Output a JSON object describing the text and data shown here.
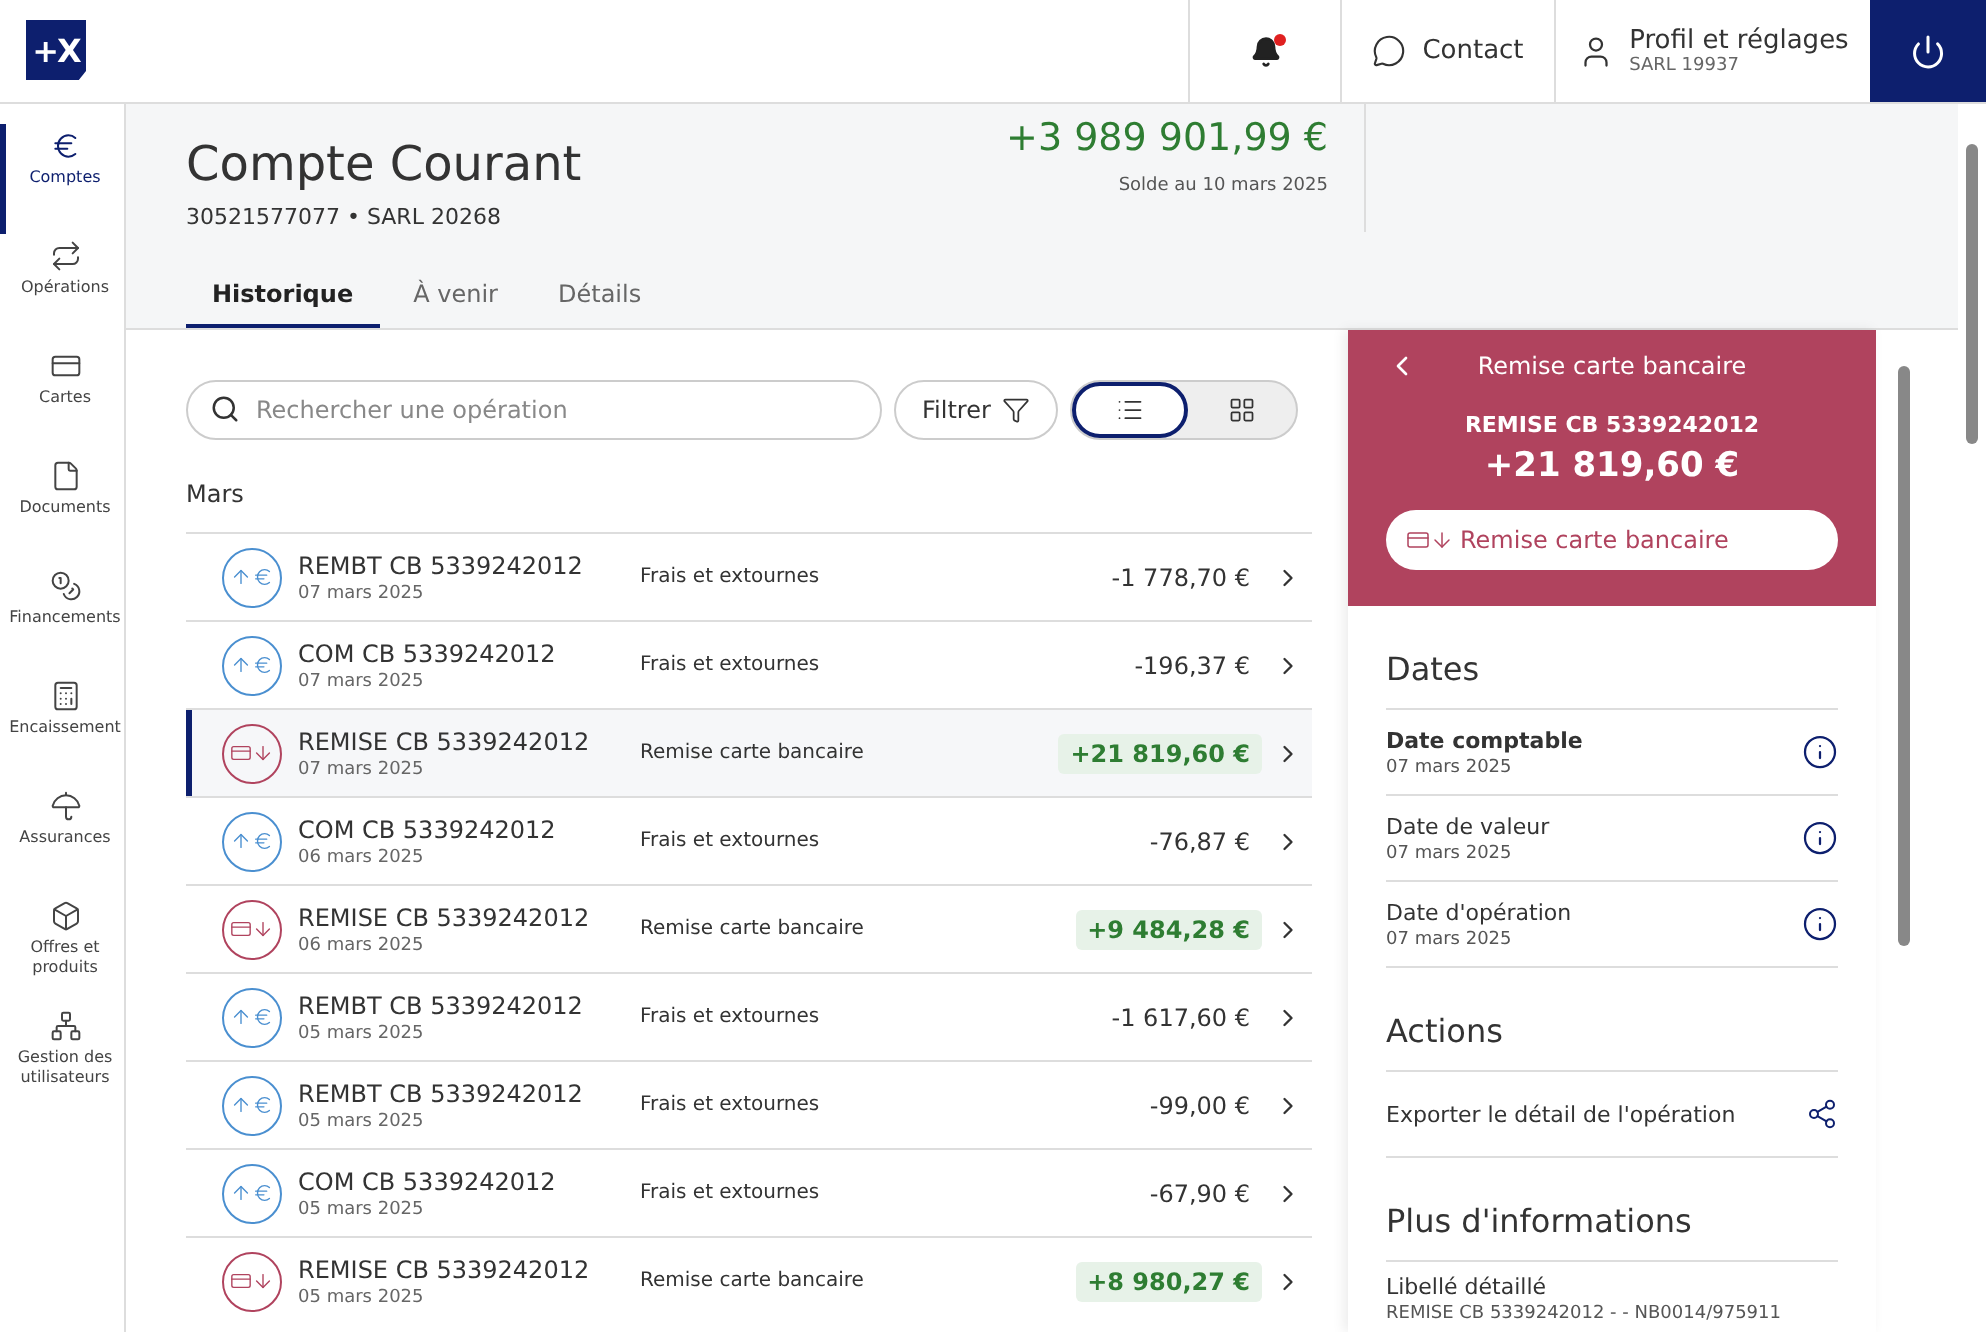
{
  "logo": "+X",
  "topbar": {
    "notification": true,
    "contact": "Contact",
    "profile": {
      "title": "Profil et réglages",
      "subtitle": "SARL 19937"
    }
  },
  "sidebar": [
    {
      "kind": "euro",
      "label": "Comptes",
      "selected": true
    },
    {
      "kind": "transfer",
      "label": "Opérations",
      "selected": false
    },
    {
      "kind": "card",
      "label": "Cartes",
      "selected": false
    },
    {
      "kind": "document",
      "label": "Documents",
      "selected": false
    },
    {
      "kind": "moneybag",
      "label": "Financements",
      "selected": false
    },
    {
      "kind": "calculator",
      "label": "Encaissement",
      "selected": false
    },
    {
      "kind": "umbrella",
      "label": "Assurances",
      "selected": false
    },
    {
      "kind": "box",
      "label": "Offres et produits",
      "selected": false
    },
    {
      "kind": "network",
      "label": "Gestion des utilisateurs",
      "selected": false
    }
  ],
  "account": {
    "title": "Compte Courant",
    "subtitle": "30521577077 • SARL 20268",
    "balance": "+3 989 901,99 €",
    "balance_note": "Solde au 10 mars 2025"
  },
  "tabs": [
    {
      "label": "Historique",
      "selected": true
    },
    {
      "label": "À venir",
      "selected": false
    },
    {
      "label": "Détails",
      "selected": false
    }
  ],
  "search": {
    "placeholder": "Rechercher une opération"
  },
  "filter": "Filtrer",
  "view_toggle": [
    {
      "kind": "list",
      "selected": true
    },
    {
      "kind": "grid",
      "selected": false
    }
  ],
  "month": "Mars",
  "operations": [
    {
      "kind": "debit",
      "name": "REMBT CB 5339242012",
      "date": "07 mars 2025",
      "category": "Frais et extournes",
      "amount": "-1 778,70 €",
      "selected": false
    },
    {
      "kind": "debit",
      "name": "COM CB 5339242012",
      "date": "07 mars 2025",
      "category": "Frais et extournes",
      "amount": "-196,37 €",
      "selected": false
    },
    {
      "kind": "credit",
      "name": "REMISE CB 5339242012",
      "date": "07 mars 2025",
      "category": "Remise carte bancaire",
      "amount": "+21 819,60 €",
      "selected": true
    },
    {
      "kind": "debit",
      "name": "COM CB 5339242012",
      "date": "06 mars 2025",
      "category": "Frais et extournes",
      "amount": "-76,87 €",
      "selected": false
    },
    {
      "kind": "credit",
      "name": "REMISE CB 5339242012",
      "date": "06 mars 2025",
      "category": "Remise carte bancaire",
      "amount": "+9 484,28 €",
      "selected": false
    },
    {
      "kind": "debit",
      "name": "REMBT CB 5339242012",
      "date": "05 mars 2025",
      "category": "Frais et extournes",
      "amount": "-1 617,60 €",
      "selected": false
    },
    {
      "kind": "debit",
      "name": "REMBT CB 5339242012",
      "date": "05 mars 2025",
      "category": "Frais et extournes",
      "amount": "-99,00 €",
      "selected": false
    },
    {
      "kind": "debit",
      "name": "COM CB 5339242012",
      "date": "05 mars 2025",
      "category": "Frais et extournes",
      "amount": "-67,90 €",
      "selected": false
    },
    {
      "kind": "credit",
      "name": "REMISE CB 5339242012",
      "date": "05 mars 2025",
      "category": "Remise carte bancaire",
      "amount": "+8 980,27 €",
      "selected": false
    }
  ],
  "detail": {
    "title": "Remise carte bancaire",
    "name": "REMISE CB 5339242012",
    "amount": "+21 819,60 €",
    "chip": "Remise carte bancaire",
    "sections": [
      {
        "heading": "Dates",
        "items": [
          {
            "kind": "date",
            "label": "Date comptable",
            "value": "07 mars 2025",
            "emphasized": true
          },
          {
            "kind": "date",
            "label": "Date de valeur",
            "value": "07 mars 2025",
            "emphasized": false
          },
          {
            "kind": "date",
            "label": "Date d'opération",
            "value": "07 mars 2025",
            "emphasized": false
          }
        ]
      },
      {
        "heading": "Actions",
        "items": [
          {
            "kind": "action",
            "label": "Exporter le détail de l'opération"
          }
        ]
      },
      {
        "heading": "Plus d'informations",
        "items": [
          {
            "kind": "info",
            "label": "Libellé détaillé",
            "value": "REMISE CB 5339242012 - - NB0014/975911"
          }
        ]
      }
    ]
  }
}
